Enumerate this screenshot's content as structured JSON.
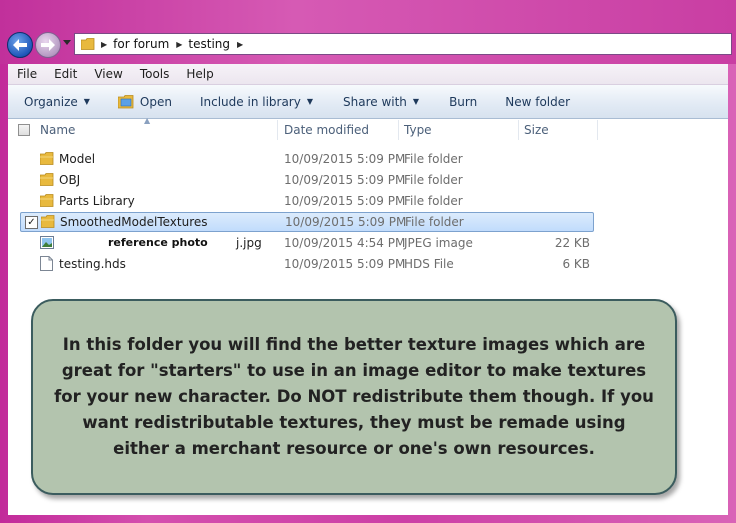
{
  "breadcrumb": [
    "for forum",
    "testing"
  ],
  "menu": [
    "File",
    "Edit",
    "View",
    "Tools",
    "Help"
  ],
  "toolbar": {
    "organize": "Organize",
    "open": "Open",
    "include_in_library": "Include in library",
    "share_with": "Share with",
    "burn": "Burn",
    "new_folder": "New folder"
  },
  "columns": {
    "name": "Name",
    "date_modified": "Date modified",
    "type": "Type",
    "size": "Size"
  },
  "files": [
    {
      "name": "Model",
      "date": "10/09/2015 5:09 PM",
      "type": "File folder",
      "size": "",
      "icon": "folder-icon"
    },
    {
      "name": "OBJ",
      "date": "10/09/2015 5:09 PM",
      "type": "File folder",
      "size": "",
      "icon": "folder-icon"
    },
    {
      "name": "Parts Library",
      "date": "10/09/2015 5:09 PM",
      "type": "File folder",
      "size": "",
      "icon": "folder-icon"
    },
    {
      "name": "SmoothedModelTextures",
      "date": "10/09/2015 5:09 PM",
      "type": "File folder",
      "size": "",
      "icon": "folder-icon",
      "selected": true
    },
    {
      "name_label": "reference photo",
      "name_suffix": "j.jpg",
      "date": "10/09/2015 4:54 PM",
      "type": "JPEG image",
      "size": "22 KB",
      "icon": "image-file-icon"
    },
    {
      "name": "testing.hds",
      "date": "10/09/2015 5:09 PM",
      "type": "HDS File",
      "size": "6 KB",
      "icon": "document-file-icon"
    }
  ],
  "callout": {
    "text": "In this folder you will find the better texture images which are great for \"starters\" to use in an image editor to make textures for your new character. Do NOT redistribute them though. If you want redistributable textures, they must be remade using either a merchant resource or one's own resources."
  },
  "colors": {
    "window_frame": "#cc3fa6",
    "toolbar_text": "#1e395b",
    "selection": "#c1dcfc",
    "callout_fill": "#b3c4ae",
    "callout_border": "#3b5c5e",
    "folder": "#e8b93e"
  }
}
